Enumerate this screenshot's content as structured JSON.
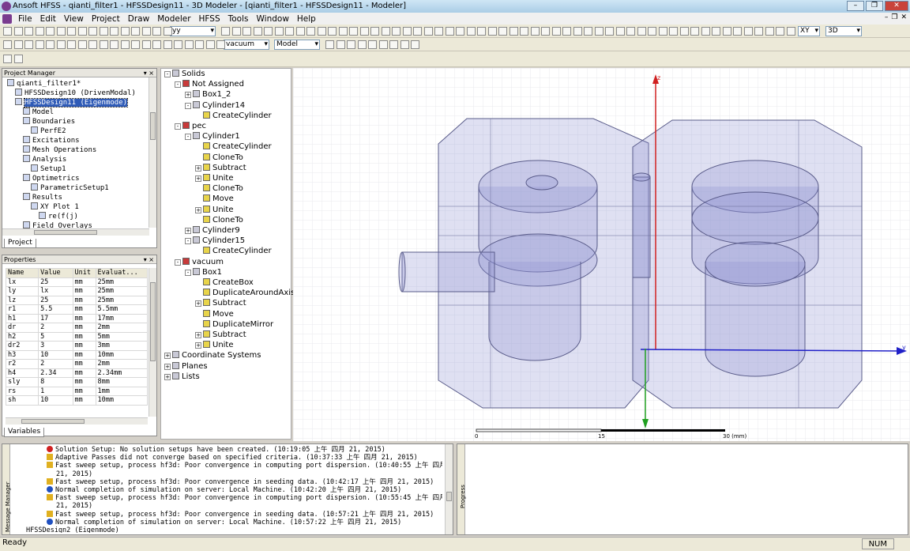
{
  "window": {
    "title": "Ansoft HFSS - qianti_filter1 - HFSSDesign11 - 3D Modeler - [qianti_filter1 - HFSSDesign11 - Modeler]"
  },
  "menu": [
    "File",
    "Edit",
    "View",
    "Project",
    "Draw",
    "Modeler",
    "HFSS",
    "Tools",
    "Window",
    "Help"
  ],
  "toolbar": {
    "plane_select": "XY",
    "view_select": "3D",
    "field_select": "yy",
    "material_select": "vacuum",
    "mode_select": "Model"
  },
  "project_manager": {
    "title": "Project Manager",
    "tab": "Project",
    "items": [
      {
        "label": "qianti_filter1*",
        "level": 0,
        "icon": "project-icon"
      },
      {
        "label": "HFSSDesign10 (DrivenModal)",
        "level": 1,
        "icon": "design-icon"
      },
      {
        "label": "HFSSDesign11 (Eigenmode)",
        "level": 1,
        "icon": "design-icon",
        "selected": true
      },
      {
        "label": "Model",
        "level": 2,
        "icon": "model-icon"
      },
      {
        "label": "Boundaries",
        "level": 2,
        "icon": "boundaries-icon"
      },
      {
        "label": "PerfE2",
        "level": 3,
        "icon": "perfe-icon"
      },
      {
        "label": "Excitations",
        "level": 2,
        "icon": "excitations-icon"
      },
      {
        "label": "Mesh Operations",
        "level": 2,
        "icon": "mesh-icon"
      },
      {
        "label": "Analysis",
        "level": 2,
        "icon": "analysis-icon"
      },
      {
        "label": "Setup1",
        "level": 3,
        "icon": "setup-icon"
      },
      {
        "label": "Optimetrics",
        "level": 2,
        "icon": "optimetrics-icon"
      },
      {
        "label": "ParametricSetup1",
        "level": 3,
        "icon": "parametric-icon"
      },
      {
        "label": "Results",
        "level": 2,
        "icon": "results-icon"
      },
      {
        "label": "XY Plot 1",
        "level": 3,
        "icon": "xyplot-icon"
      },
      {
        "label": "re(f(j)",
        "level": 4,
        "icon": "trace-icon"
      },
      {
        "label": "Field Overlays",
        "level": 2,
        "icon": "field-icon"
      }
    ]
  },
  "properties": {
    "title": "Properties",
    "tab": "Variables",
    "headers": [
      "Name",
      "Value",
      "Unit",
      "Evaluat..."
    ],
    "rows": [
      [
        "lx",
        "25",
        "mm",
        "25mm"
      ],
      [
        "ly",
        "lx",
        "mm",
        "25mm"
      ],
      [
        "lz",
        "25",
        "mm",
        "25mm"
      ],
      [
        "r1",
        "5.5",
        "mm",
        "5.5mm"
      ],
      [
        "h1",
        "17",
        "mm",
        "17mm"
      ],
      [
        "dr",
        "2",
        "mm",
        "2mm"
      ],
      [
        "h2",
        "5",
        "mm",
        "5mm"
      ],
      [
        "dr2",
        "3",
        "mm",
        "3mm"
      ],
      [
        "h3",
        "10",
        "mm",
        "10mm"
      ],
      [
        "r2",
        "2",
        "mm",
        "2mm"
      ],
      [
        "h4",
        "2.34",
        "mm",
        "2.34mm"
      ],
      [
        "sly",
        "8",
        "mm",
        "8mm"
      ],
      [
        "rs",
        "1",
        "mm",
        "1mm"
      ],
      [
        "sh",
        "10",
        "mm",
        "10mm"
      ]
    ]
  },
  "model_tree": [
    {
      "label": "Solids",
      "level": 0,
      "exp": "-"
    },
    {
      "label": "Not Assigned",
      "level": 1,
      "exp": "-"
    },
    {
      "label": "Box1_2",
      "level": 2,
      "exp": "+"
    },
    {
      "label": "Cylinder14",
      "level": 2,
      "exp": "-"
    },
    {
      "label": "CreateCylinder",
      "level": 3,
      "exp": ""
    },
    {
      "label": "pec",
      "level": 1,
      "exp": "-"
    },
    {
      "label": "Cylinder1",
      "level": 2,
      "exp": "-"
    },
    {
      "label": "CreateCylinder",
      "level": 3,
      "exp": ""
    },
    {
      "label": "CloneTo",
      "level": 3,
      "exp": ""
    },
    {
      "label": "Subtract",
      "level": 3,
      "exp": "+"
    },
    {
      "label": "Unite",
      "level": 3,
      "exp": "+"
    },
    {
      "label": "CloneTo",
      "level": 3,
      "exp": ""
    },
    {
      "label": "Move",
      "level": 3,
      "exp": ""
    },
    {
      "label": "Unite",
      "level": 3,
      "exp": "+"
    },
    {
      "label": "CloneTo",
      "level": 3,
      "exp": ""
    },
    {
      "label": "Cylinder9",
      "level": 2,
      "exp": "+"
    },
    {
      "label": "Cylinder15",
      "level": 2,
      "exp": "-"
    },
    {
      "label": "CreateCylinder",
      "level": 3,
      "exp": ""
    },
    {
      "label": "vacuum",
      "level": 1,
      "exp": "-"
    },
    {
      "label": "Box1",
      "level": 2,
      "exp": "-"
    },
    {
      "label": "CreateBox",
      "level": 3,
      "exp": ""
    },
    {
      "label": "DuplicateAroundAxis",
      "level": 3,
      "exp": ""
    },
    {
      "label": "Subtract",
      "level": 3,
      "exp": "+"
    },
    {
      "label": "Move",
      "level": 3,
      "exp": ""
    },
    {
      "label": "DuplicateMirror",
      "level": 3,
      "exp": ""
    },
    {
      "label": "Subtract",
      "level": 3,
      "exp": "+"
    },
    {
      "label": "Unite",
      "level": 3,
      "exp": "+"
    },
    {
      "label": "Coordinate Systems",
      "level": 0,
      "exp": "+"
    },
    {
      "label": "Planes",
      "level": 0,
      "exp": "+"
    },
    {
      "label": "Lists",
      "level": 0,
      "exp": "+"
    }
  ],
  "viewport": {
    "axes": {
      "z": "z",
      "y": "y"
    },
    "scale": {
      "ticks": [
        "0",
        "15",
        "30 (mm)"
      ]
    }
  },
  "messages": {
    "side_label": "Message Manager",
    "progress_label": "Progress",
    "rows": [
      {
        "type": "error",
        "text": "Solution Setup: No solution setups have been created. (10:19:05 上午  四月 21, 2015)"
      },
      {
        "type": "warning",
        "text": "Adaptive Passes did not converge based on specified criteria. (10:37:33 上午  四月 21, 2015)"
      },
      {
        "type": "warning",
        "text": "Fast sweep setup, process hf3d: Poor convergence in computing port dispersion. (10:40:55 上午  四月"
      },
      {
        "type": "cont",
        "text": "21, 2015)"
      },
      {
        "type": "warning",
        "text": "Fast sweep setup, process hf3d: Poor convergence in seeding data. (10:42:17 上午  四月 21, 2015)"
      },
      {
        "type": "info",
        "text": "Normal completion of simulation on server: Local Machine. (10:42:20 上午  四月 21, 2015)"
      },
      {
        "type": "warning",
        "text": "Fast sweep setup, process hf3d: Poor convergence in computing port dispersion. (10:55:45 上午  四月"
      },
      {
        "type": "cont",
        "text": "21, 2015)"
      },
      {
        "type": "warning",
        "text": "Fast sweep setup, process hf3d: Poor convergence in seeding data. (10:57:21 上午  四月 21, 2015)"
      },
      {
        "type": "info",
        "text": "Normal completion of simulation on server: Local Machine. (10:57:22 上午  四月 21, 2015)"
      },
      {
        "type": "tree",
        "text": "HFSSDesign2 (Eigenmode)"
      }
    ]
  },
  "status": {
    "text": "Ready",
    "num": "NUM"
  }
}
